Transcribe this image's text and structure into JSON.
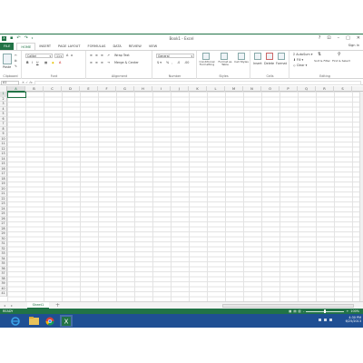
{
  "window": {
    "title": "Book1 - Excel",
    "signin": "Sign in"
  },
  "ribbon_tabs": [
    "FILE",
    "HOME",
    "INSERT",
    "PAGE LAYOUT",
    "FORMULAS",
    "DATA",
    "REVIEW",
    "VIEW"
  ],
  "ribbon": {
    "clipboard": {
      "paste": "Paste",
      "label": "Clipboard"
    },
    "font": {
      "family": "Calibri",
      "size": "11",
      "label": "Font"
    },
    "alignment": {
      "wrap_text": "Wrap Text",
      "merge_center": "Merge & Center",
      "label": "Alignment"
    },
    "number": {
      "format": "General",
      "label": "Number"
    },
    "styles": {
      "conditional": "Conditional Formatting",
      "format_table": "Format as Table",
      "cell_styles": "Cell Styles",
      "label": "Styles"
    },
    "cells": {
      "insert": "Insert",
      "delete": "Delete",
      "format": "Format",
      "label": "Cells"
    },
    "editing": {
      "autosum": "AutoSum",
      "fill": "Fill",
      "clear": "Clear",
      "sort_filter": "Sort & Filter",
      "find_select": "Find & Select",
      "label": "Editing"
    }
  },
  "formula_bar": {
    "name_box": "A1",
    "fx": "fx",
    "value": ""
  },
  "grid": {
    "columns": [
      "A",
      "B",
      "C",
      "D",
      "E",
      "F",
      "G",
      "H",
      "I",
      "J",
      "K",
      "L",
      "M",
      "N",
      "O",
      "P",
      "Q",
      "R",
      "S"
    ],
    "rows": 41,
    "active_cell": "A1"
  },
  "sheets": {
    "tabs": [
      "Sheet1"
    ],
    "add": "+"
  },
  "status": {
    "ready": "READY",
    "zoom": "100%"
  },
  "taskbar": {
    "time": "4:30 PM",
    "date": "6/25/2013",
    "apps": [
      "ie-icon",
      "explorer-icon",
      "chrome-icon",
      "excel-icon"
    ]
  }
}
